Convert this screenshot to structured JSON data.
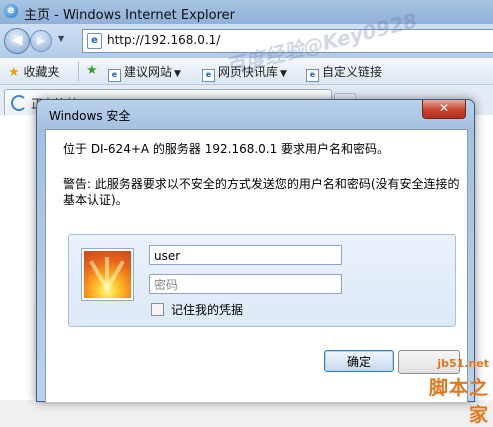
{
  "window": {
    "title": "主页 - Windows Internet Explorer"
  },
  "navbar": {
    "address": "http://192.168.0.1/"
  },
  "favorites_bar": {
    "favorites_label": "收藏夹",
    "items": [
      {
        "label": "建议网站"
      },
      {
        "label": "网页快讯库"
      },
      {
        "label": "自定义链接"
      }
    ]
  },
  "tab": {
    "label": "正在连接..."
  },
  "watermark": "百度经验@Key0928",
  "dialog": {
    "title": "Windows 安全",
    "close_glyph": "✕",
    "message": "位于 DI-624+A 的服务器 192.168.0.1 要求用户名和密码。",
    "warning": "警告: 此服务器要求以不安全的方式发送您的用户名和密码(没有安全连接的基本认证)。",
    "username_value": "user",
    "password_placeholder": "密码",
    "remember_label": "记住我的凭据",
    "ok_label": "确定"
  },
  "site_logo": {
    "url": "jb51.net",
    "name": "脚本之家"
  }
}
